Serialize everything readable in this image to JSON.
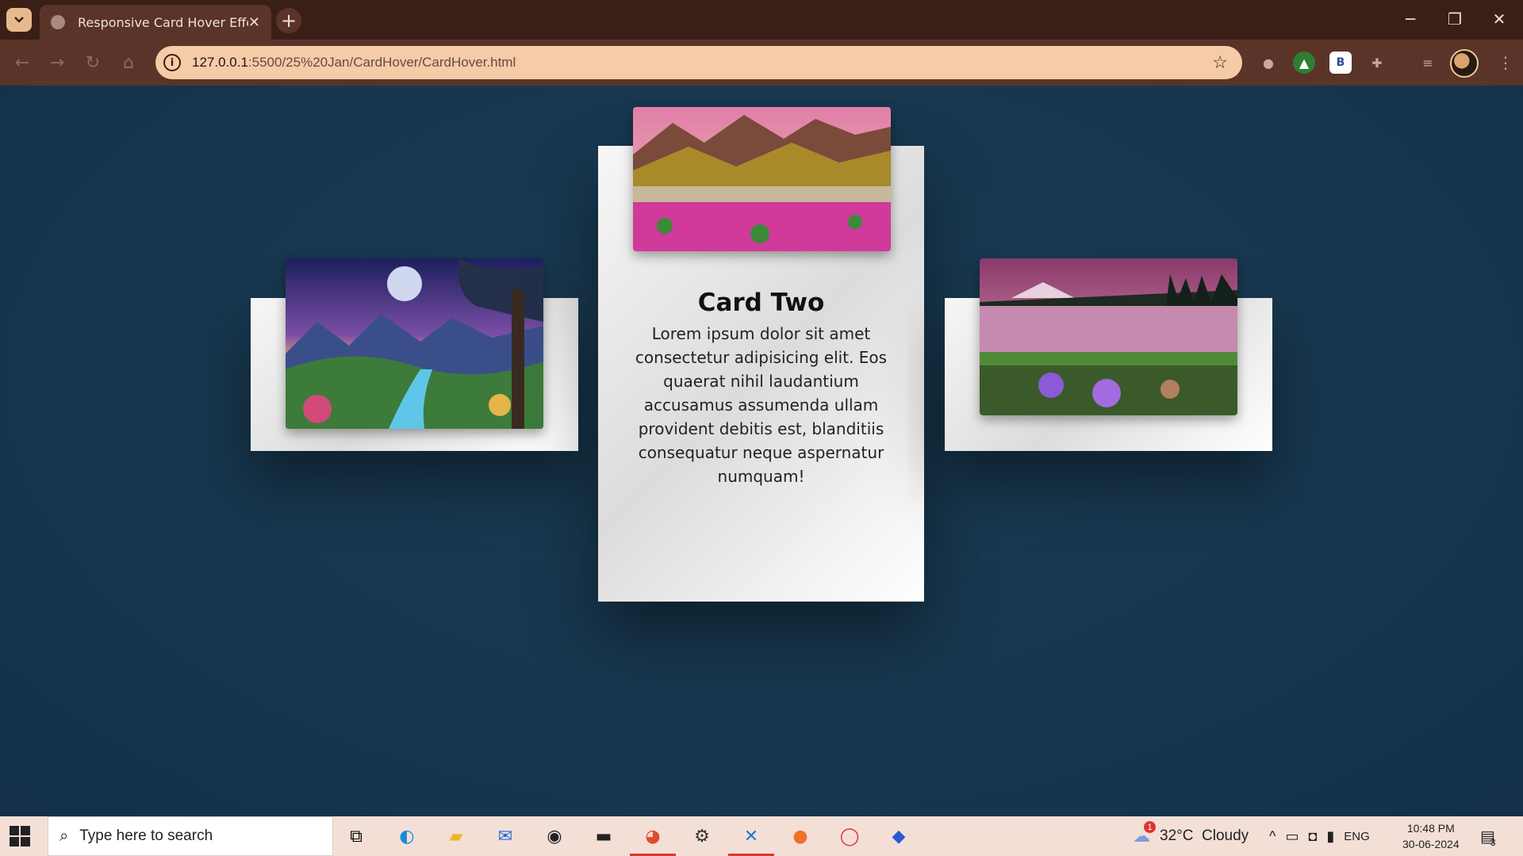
{
  "browser": {
    "tab_title": "Responsive Card Hover Effect",
    "tab_close": "✕",
    "new_tab": "+",
    "url_host": "127.0.0.1",
    "url_path": ":5500/25%20Jan/CardHover/CardHover.html",
    "extension_badge": "B"
  },
  "window_controls": {
    "minimize": "─",
    "restore": "❐",
    "close": "✕"
  },
  "cards": [
    {
      "position": "left",
      "title": "",
      "image": "fantasy-night-landscape"
    },
    {
      "position": "center",
      "title": "Card Two",
      "text": "Lorem ipsum dolor sit amet consectetur adipisicing elit. Eos quaerat nihil laudantium accusamus assumenda ullam provident debitis est, blanditiis consequatur neque aspernatur numquam!",
      "image": "mountain-flower-meadow"
    },
    {
      "position": "right",
      "title": "",
      "image": "lake-sunset-flowers"
    }
  ],
  "taskbar": {
    "search_placeholder": "Type here to search",
    "weather": "32°C  Cloudy",
    "weather_badge": "1",
    "language": "ENG",
    "time": "10:48 PM",
    "date": "30-06-2024",
    "notifications": "3"
  },
  "colors": {
    "titlebar": "#3a1f16",
    "navbar": "#5a3428",
    "omnibox": "#f5cba8",
    "page_bg": "#16344b",
    "taskbar": "#f3dfd6"
  }
}
